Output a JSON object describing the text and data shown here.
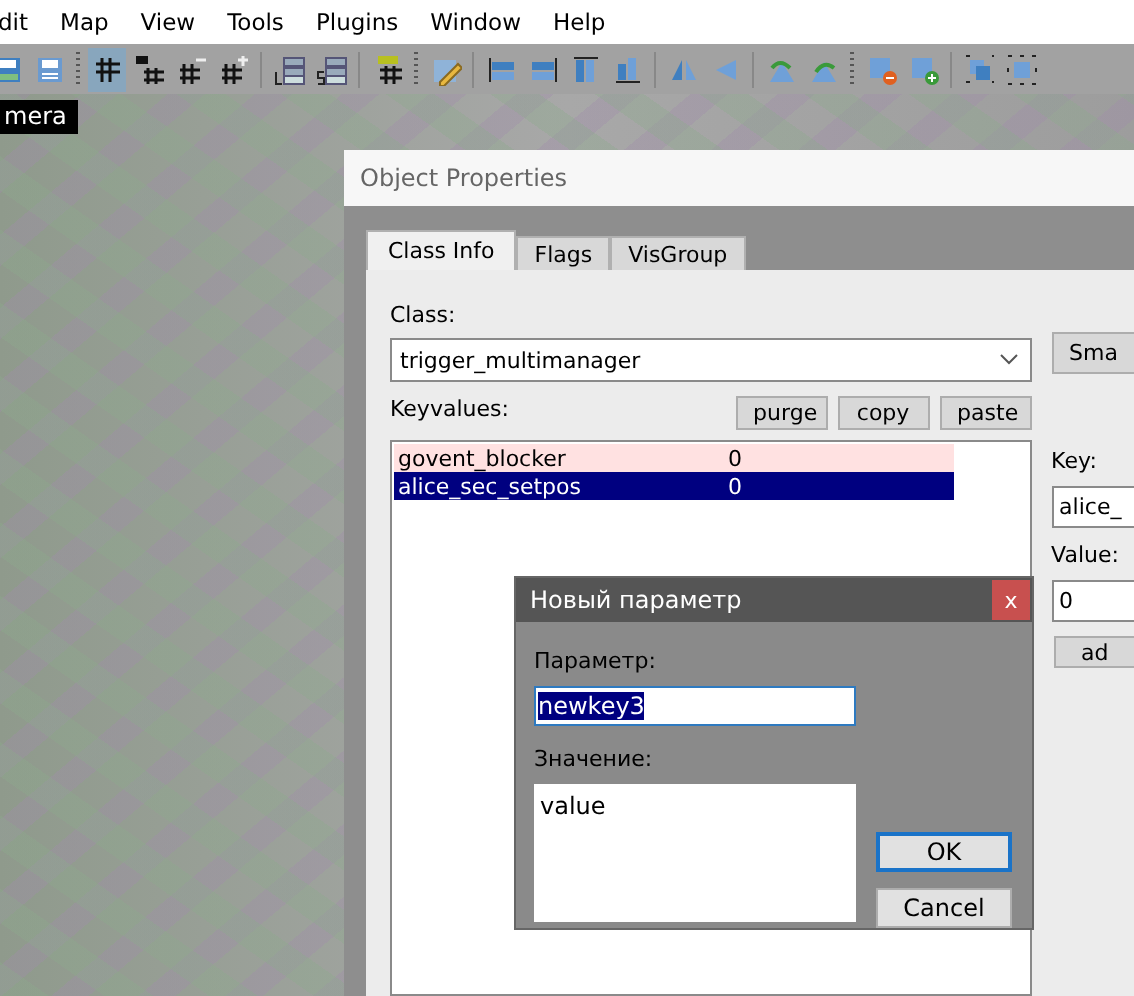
{
  "menu": [
    {
      "label": "dit"
    },
    {
      "label": "Map"
    },
    {
      "label": "View"
    },
    {
      "label": "Tools"
    },
    {
      "label": "Plugins"
    },
    {
      "label": "Window"
    },
    {
      "label": "Help"
    }
  ],
  "toolbar": [
    {
      "kind": "save",
      "selected": false
    },
    {
      "kind": "saveas",
      "selected": false
    },
    {
      "kind": "grip"
    },
    {
      "kind": "grid",
      "selected": true
    },
    {
      "kind": "grid3d",
      "selected": false
    },
    {
      "kind": "gridminus",
      "selected": false
    },
    {
      "kind": "gridplus",
      "selected": false
    },
    {
      "kind": "sep"
    },
    {
      "kind": "layerl",
      "selected": false
    },
    {
      "kind": "layers",
      "selected": false
    },
    {
      "kind": "sep"
    },
    {
      "kind": "uvgrid",
      "selected": false
    },
    {
      "kind": "grip"
    },
    {
      "kind": "pencil",
      "selected": false
    },
    {
      "kind": "sep"
    },
    {
      "kind": "alignleft",
      "selected": false
    },
    {
      "kind": "alignright",
      "selected": false
    },
    {
      "kind": "aligntop",
      "selected": false
    },
    {
      "kind": "alignbottom",
      "selected": false
    },
    {
      "kind": "sep"
    },
    {
      "kind": "mirrorh",
      "selected": false
    },
    {
      "kind": "mirrorv",
      "selected": false
    },
    {
      "kind": "sep"
    },
    {
      "kind": "rotateleft",
      "selected": false
    },
    {
      "kind": "rotateright",
      "selected": false
    },
    {
      "kind": "grip"
    },
    {
      "kind": "shapeminus",
      "selected": false
    },
    {
      "kind": "shapeplus",
      "selected": false
    },
    {
      "kind": "sep"
    },
    {
      "kind": "group",
      "selected": false
    },
    {
      "kind": "select",
      "selected": false
    }
  ],
  "viewport": {
    "camera_label": "mera"
  },
  "properties": {
    "title": "Object Properties",
    "tabs": [
      {
        "label": "Class Info",
        "selected": true
      },
      {
        "label": "Flags",
        "selected": false
      },
      {
        "label": "VisGroup",
        "selected": false
      }
    ],
    "class_label": "Class:",
    "class_value": "trigger_multimanager",
    "smart_button": "Sma",
    "keyvalues_label": "Keyvalues:",
    "buttons": [
      "purge",
      "copy",
      "paste"
    ],
    "keyvalues": [
      {
        "key": "govent_blocker",
        "value": "0",
        "highlighted": true,
        "selected": false
      },
      {
        "key": "alice_sec_setpos",
        "value": "0",
        "highlighted": false,
        "selected": true
      }
    ],
    "key_label": "Key:",
    "key_value": "alice_",
    "value_label": "Value:",
    "value_value": "0",
    "add_button": "ad"
  },
  "dialog": {
    "title": "Новый параметр",
    "close": "x",
    "param_label": "Параметр:",
    "param_value": "newkey3",
    "param_selected": true,
    "value_label": "Значение:",
    "value_value": "value",
    "buttons": [
      {
        "label": "OK",
        "default": true
      },
      {
        "label": "Cancel",
        "default": false
      }
    ]
  }
}
